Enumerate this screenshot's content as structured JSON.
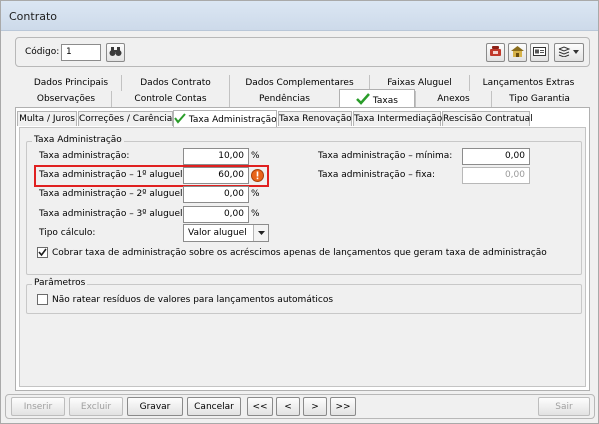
{
  "window": {
    "title": "Contrato"
  },
  "header": {
    "code_label": "Código:",
    "code_value": "1"
  },
  "tabs_row1": [
    "Dados Principais",
    "Dados Contrato",
    "Dados Complementares",
    "Faixas Aluguel",
    "Lançamentos Extras"
  ],
  "tabs_row2": [
    "Observações",
    "Controle Contas",
    "Pendências",
    "Taxas",
    "Anexos",
    "Tipo Garantia"
  ],
  "subtabs": [
    "Multa / Juros",
    "Correções / Carência",
    "Taxa Administração",
    "Taxa Renovação",
    "Taxa Intermediação",
    "Rescisão Contratual"
  ],
  "taxa_admin": {
    "group_title": "Taxa Administração",
    "admin_label": "Taxa administração:",
    "admin_value": "10,00",
    "first_label": "Taxa administração – 1º aluguel:",
    "first_value": "60,00",
    "second_label": "Taxa administração – 2º aluguel:",
    "second_value": "0,00",
    "third_label": "Taxa administração – 3º aluguel:",
    "third_value": "0,00",
    "percent": "%",
    "calc_label": "Tipo cálculo:",
    "calc_value": "Valor aluguel",
    "min_label": "Taxa administração – mínima:",
    "min_value": "0,00",
    "fixed_label": "Taxa administração – fixa:",
    "fixed_value": "0,00",
    "charge_checkbox_label": "Cobrar taxa de administração sobre os acréscimos apenas de lançamentos que geram taxa de administração",
    "charge_checked": true
  },
  "parametros": {
    "group_title": "Parâmetros",
    "checkbox_label": "Não ratear resíduos de valores para lançamentos automáticos",
    "checked": false
  },
  "footer": {
    "insert": "Inserir",
    "delete": "Excluir",
    "save": "Gravar",
    "cancel": "Cancelar",
    "first": "<<",
    "prev": "<",
    "next": ">",
    "last": ">>",
    "exit": "Sair"
  },
  "colors": {
    "highlight": "#e02020",
    "check_green": "#2a9d2a",
    "warning_orange": "#e8641a"
  }
}
